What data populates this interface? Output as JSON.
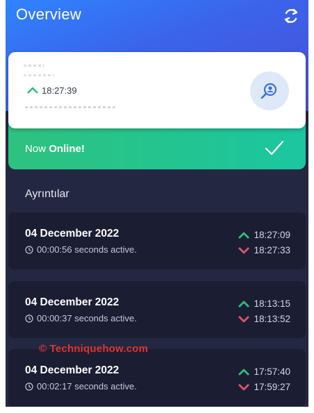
{
  "header": {
    "title": "Overview",
    "refresh_icon": "refresh-icon"
  },
  "user_card": {
    "last_seen_time": "18:27:39",
    "search_icon": "search-person-icon"
  },
  "status": {
    "prefix": "Now",
    "state": "Online!",
    "check_icon": "check-icon"
  },
  "section_title": "Ayrıntılar",
  "sessions": [
    {
      "date": "04 December 2022",
      "duration": "00:00:56 seconds active.",
      "online_at": "18:27:09",
      "offline_at": "18:27:33"
    },
    {
      "date": "04 December 2022",
      "duration": "00:00:37 seconds active.",
      "online_at": "18:13:15",
      "offline_at": "18:13:52"
    },
    {
      "date": "04 December 2022",
      "duration": "00:02:17 seconds active.",
      "online_at": "17:57:40",
      "offline_at": "17:59:27"
    }
  ],
  "watermark": "© Techniquehow.com",
  "colors": {
    "header_blue": "#3b63ea",
    "online_green": "#2ec27f",
    "background": "#242742",
    "card": "#1b1d33",
    "up_arrow": "#2fbf7a",
    "down_arrow": "#e0526a",
    "watermark": "#e0352c"
  }
}
